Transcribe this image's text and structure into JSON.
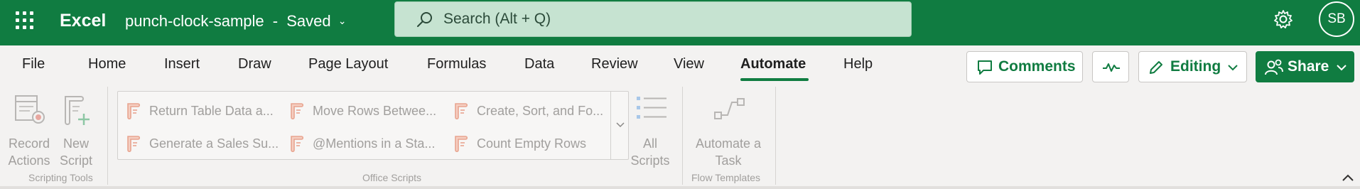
{
  "titlebar": {
    "app_name": "Excel",
    "doc_name": "punch-clock-sample",
    "separator": "-",
    "status": "Saved",
    "search_placeholder": "Search (Alt + Q)",
    "avatar_initials": "SB",
    "bg_color": "#107c41"
  },
  "tabs": [
    {
      "label": "File"
    },
    {
      "label": "Home"
    },
    {
      "label": "Insert"
    },
    {
      "label": "Draw"
    },
    {
      "label": "Page Layout"
    },
    {
      "label": "Formulas"
    },
    {
      "label": "Data"
    },
    {
      "label": "Review"
    },
    {
      "label": "View"
    },
    {
      "label": "Automate",
      "active": true
    },
    {
      "label": "Help"
    }
  ],
  "right_buttons": {
    "comments": "Comments",
    "editing": "Editing",
    "share": "Share"
  },
  "ribbon": {
    "record_actions": [
      "Record",
      "Actions"
    ],
    "new_script": [
      "New",
      "Script"
    ],
    "scripting_tools_label": "Scripting Tools",
    "scripts": [
      "Return Table Data a...",
      "Move Rows Betwee...",
      "Create, Sort, and Fo...",
      "Generate a Sales Su...",
      "@Mentions in a Sta...",
      "Count Empty Rows"
    ],
    "all_scripts": [
      "All",
      "Scripts"
    ],
    "office_scripts_label": "Office Scripts",
    "automate_task": [
      "Automate a",
      "Task"
    ],
    "flow_templates_label": "Flow Templates"
  },
  "icons": [
    "waffle-icon",
    "search-icon",
    "gear-icon",
    "chevron-down-icon",
    "comment-icon",
    "activity-icon",
    "pencil-icon",
    "people-icon",
    "script-icon",
    "record-icon",
    "new-script-icon",
    "list-icon",
    "flow-icon",
    "chevron-up-icon"
  ]
}
